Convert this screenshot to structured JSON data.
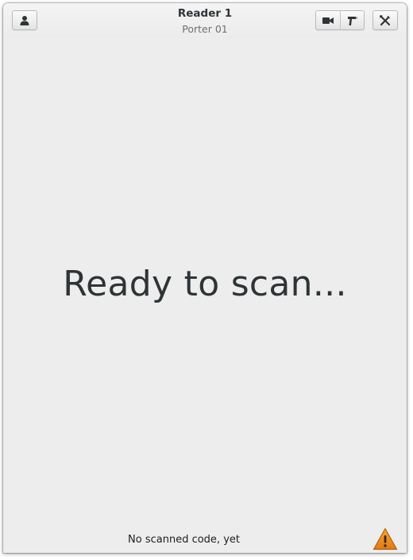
{
  "header": {
    "title": "Reader 1",
    "subtitle": "Porter 01",
    "left_button_icon": "user-icon",
    "right_group_icons": [
      "video-camera-icon",
      "barcode-scanner-icon"
    ],
    "settings_icon": "tools-icon"
  },
  "main": {
    "message": "Ready to scan..."
  },
  "statusbar": {
    "text": "No scanned code, yet",
    "status_icon": "warning-icon",
    "warning_color": "#e07b12"
  }
}
